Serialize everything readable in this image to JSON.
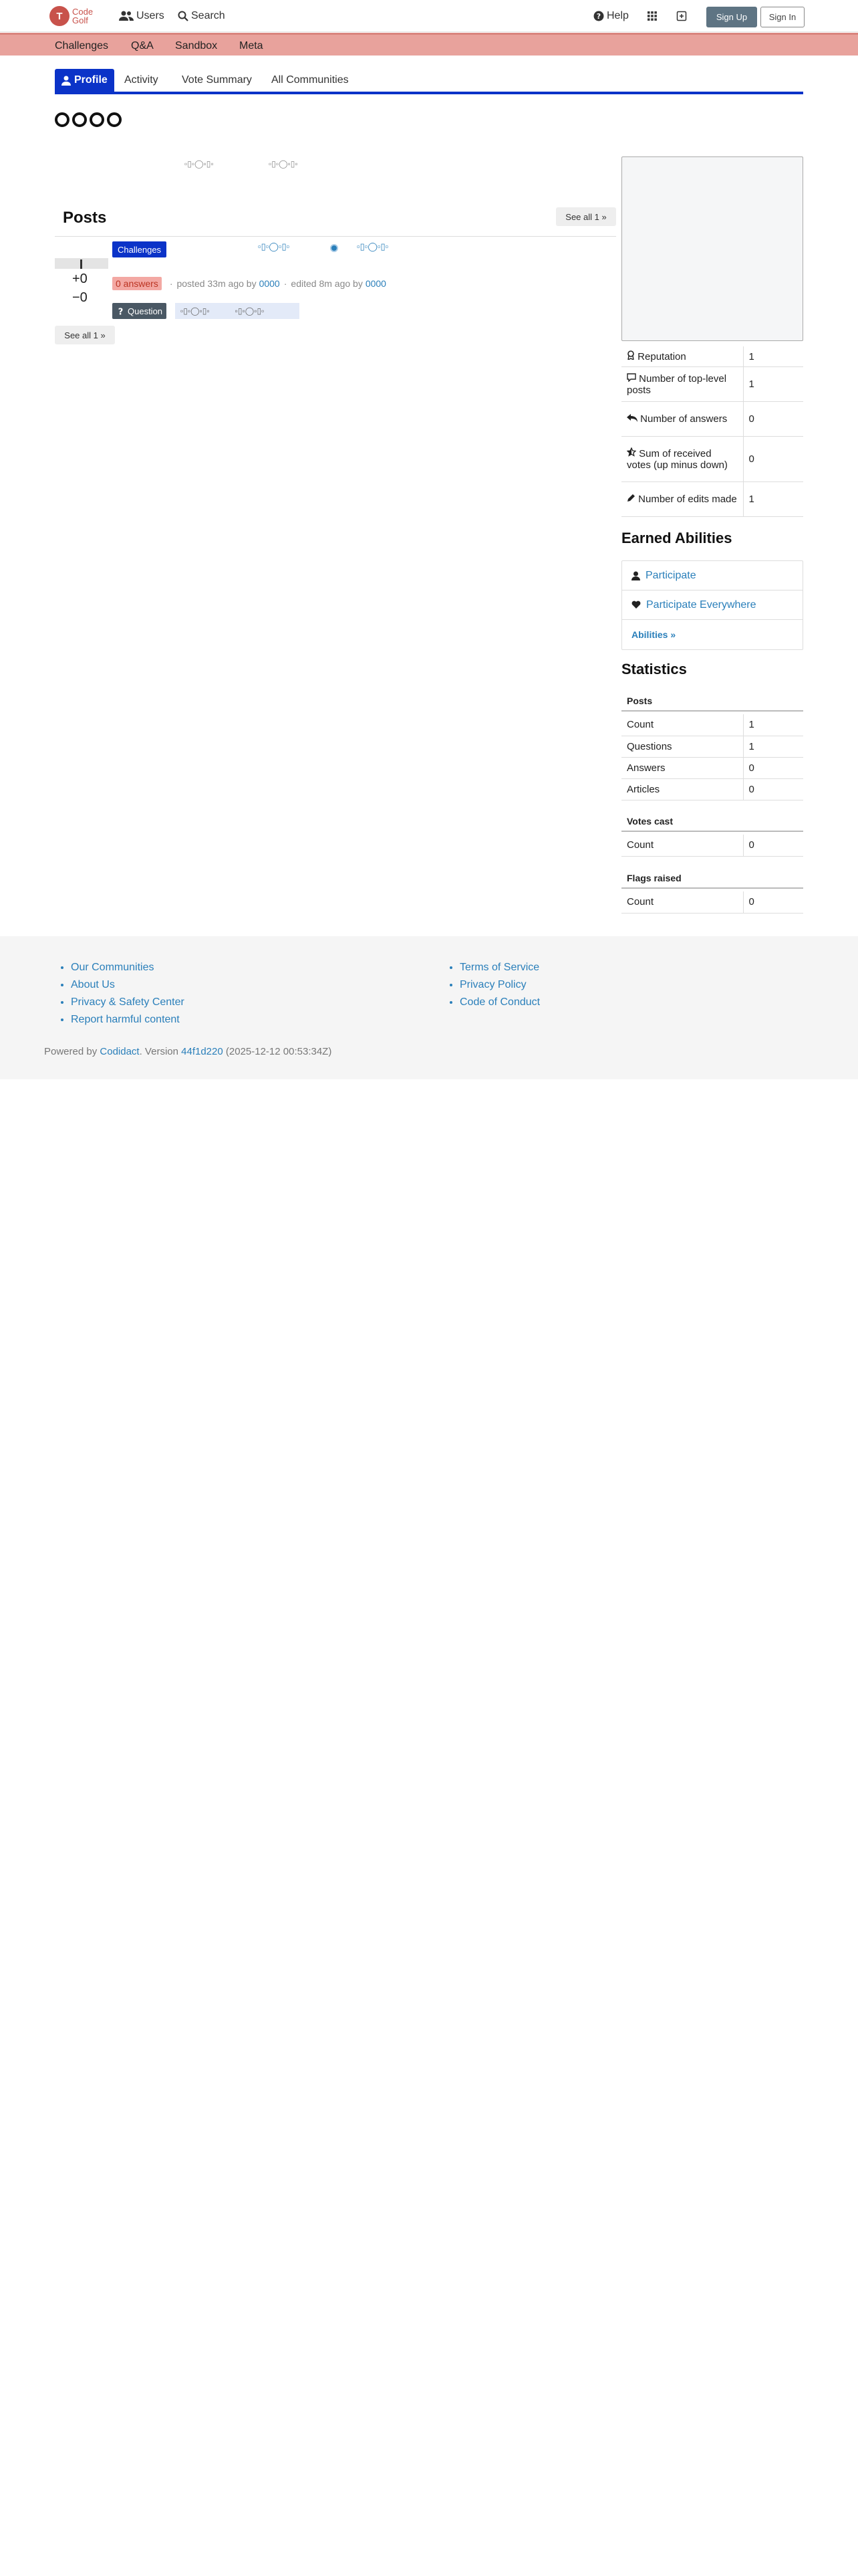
{
  "header": {
    "logo_mark": "T",
    "logo_line1": "Code",
    "logo_line2": "Golf",
    "users": "Users",
    "search": "Search",
    "help": "Help",
    "sign_up": "Sign Up",
    "sign_in": "Sign In"
  },
  "categories": [
    "Challenges",
    "Q&A",
    "Sandbox",
    "Meta"
  ],
  "tabs": [
    "Profile",
    "Activity",
    "Vote Summary",
    "All Communities"
  ],
  "profile": {
    "glyph_row_a": "▫▯▫◯▫▯▫",
    "glyph_row_b": "▫▯▫◯▫▯▫"
  },
  "posts": {
    "title": "Posts",
    "see_all_top": "See all 1 »",
    "see_all_bottom": "See all 1 »",
    "item": {
      "category": "Challenges",
      "title_glyphs_a": "▫▯▫◯▫▯▫",
      "title_glyphs_b": "▫▯▫◯▫▯▫",
      "score_up": "+0",
      "score_down": "−0",
      "answers": "0 answers",
      "posted": "posted 33m ago by",
      "posted_user": "0000",
      "edited": "edited 8m ago by",
      "edited_user": "0000",
      "type": "Question",
      "tag_glyphs_a": "▫▯▫◯▫▯▫",
      "tag_glyphs_b": "▫▯▫◯▫▯▫"
    }
  },
  "summary": [
    {
      "label": "Reputation",
      "value": "1"
    },
    {
      "label": "Number of top-level posts",
      "value": "1"
    },
    {
      "label": "Number of answers",
      "value": "0"
    },
    {
      "label": "Sum of received votes (up minus down)",
      "value": "0"
    },
    {
      "label": "Number of edits made",
      "value": "1"
    }
  ],
  "abilities": {
    "title": "Earned Abilities",
    "items": [
      "Participate",
      "Participate Everywhere"
    ],
    "more": "Abilities »"
  },
  "statistics": {
    "title": "Statistics",
    "posts_heading": "Posts",
    "posts": [
      {
        "label": "Count",
        "value": "1"
      },
      {
        "label": "Questions",
        "value": "1"
      },
      {
        "label": "Answers",
        "value": "0"
      },
      {
        "label": "Articles",
        "value": "0"
      }
    ],
    "votes_heading": "Votes cast",
    "votes": [
      {
        "label": "Count",
        "value": "0"
      }
    ],
    "flags_heading": "Flags raised",
    "flags": [
      {
        "label": "Count",
        "value": "0"
      }
    ]
  },
  "footer": {
    "left": [
      "Our Communities",
      "About Us",
      "Privacy & Safety Center",
      "Report harmful content"
    ],
    "right": [
      "Terms of Service",
      "Privacy Policy",
      "Code of Conduct"
    ],
    "powered_prefix": "Powered by",
    "powered_link": "Codidact",
    "version_prefix": ". Version",
    "version": "44f1d220",
    "version_date": "(2025-12-12 00:53:34Z)"
  }
}
